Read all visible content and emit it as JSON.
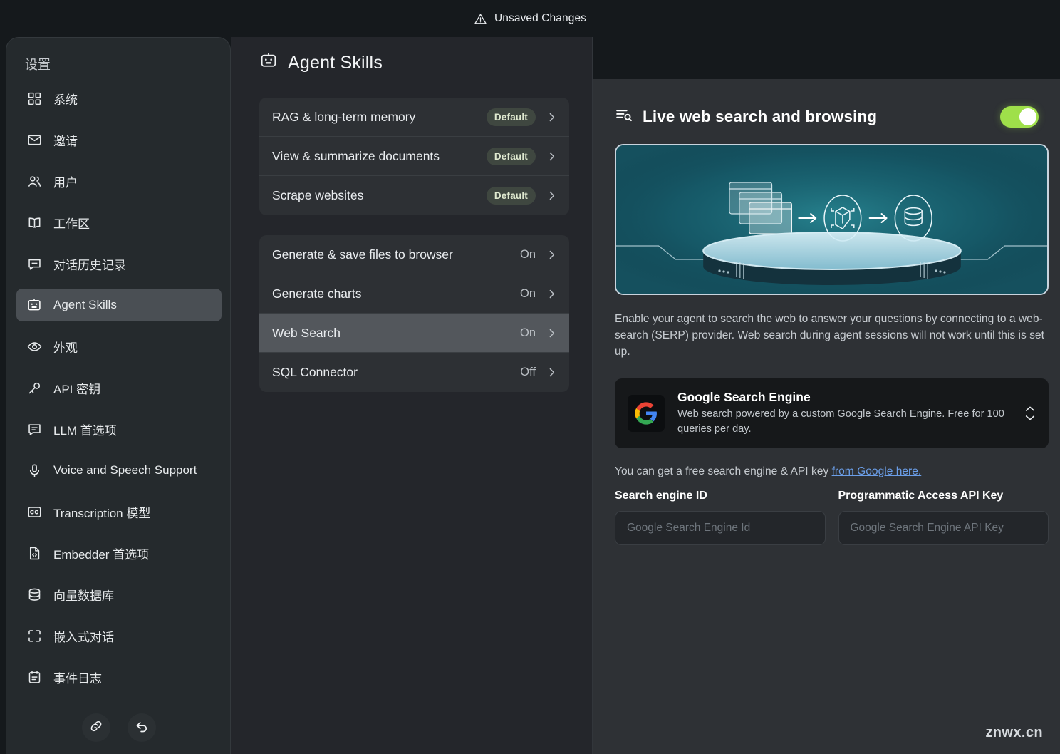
{
  "topbar": {
    "unsaved_label": "Unsaved Changes",
    "warning_icon": "warning-triangle-icon"
  },
  "sidebar": {
    "title": "设置",
    "items": [
      {
        "label": "系统",
        "icon": "grid-icon",
        "active": false
      },
      {
        "label": "邀请",
        "icon": "envelope-icon",
        "active": false
      },
      {
        "label": "用户",
        "icon": "users-icon",
        "active": false
      },
      {
        "label": "工作区",
        "icon": "book-open-icon",
        "active": false
      },
      {
        "label": "对话历史记录",
        "icon": "chat-bubble-icon",
        "active": false
      },
      {
        "label": "Agent Skills",
        "icon": "robot-icon",
        "active": true
      },
      {
        "label": "外观",
        "icon": "eye-icon",
        "active": false
      },
      {
        "label": "API 密钥",
        "icon": "key-icon",
        "active": false
      },
      {
        "label": "LLM 首选项",
        "icon": "chat-lines-icon",
        "active": false
      },
      {
        "label": "Voice and Speech Support",
        "icon": "microphone-icon",
        "active": false
      },
      {
        "label": "Transcription 模型",
        "icon": "closed-caption-icon",
        "active": false
      },
      {
        "label": "Embedder 首选项",
        "icon": "file-code-icon",
        "active": false
      },
      {
        "label": "向量数据库",
        "icon": "database-icon",
        "active": false
      },
      {
        "label": "嵌入式对话",
        "icon": "embed-icon",
        "active": false
      },
      {
        "label": "事件日志",
        "icon": "clipboard-icon",
        "active": false
      }
    ],
    "footer": [
      {
        "name": "link-button",
        "icon": "link-icon"
      },
      {
        "name": "back-button",
        "icon": "undo-arrow-icon"
      }
    ]
  },
  "main": {
    "heading": "Agent Skills",
    "heading_icon": "robot-icon",
    "groups": [
      {
        "rows": [
          {
            "label": "RAG & long-term memory",
            "badge": "Default",
            "state": "",
            "selected": false
          },
          {
            "label": "View & summarize documents",
            "badge": "Default",
            "state": "",
            "selected": false
          },
          {
            "label": "Scrape websites",
            "badge": "Default",
            "state": "",
            "selected": false
          }
        ]
      },
      {
        "rows": [
          {
            "label": "Generate & save files to browser",
            "badge": "",
            "state": "On",
            "selected": false
          },
          {
            "label": "Generate charts",
            "badge": "",
            "state": "On",
            "selected": false
          },
          {
            "label": "Web Search",
            "badge": "",
            "state": "On",
            "selected": true
          },
          {
            "label": "SQL Connector",
            "badge": "",
            "state": "Off",
            "selected": false
          }
        ]
      }
    ]
  },
  "detail": {
    "title": "Live web search and browsing",
    "title_icon": "search-list-icon",
    "toggle_on": true,
    "toggle_color": "#9fe04a",
    "hero_alt": "browser windows to cube to database pipeline illustration",
    "description": "Enable your agent to search the web to answer your questions by connecting to a web-search (SERP) provider. Web search during agent sessions will not work until this is set up.",
    "provider": {
      "name": "Google Search Engine",
      "description": "Web search powered by a custom Google Search Engine. Free for 100 queries per day.",
      "logo_icon": "google-logo-icon",
      "stepper_icon": "chevron-up-down-icon"
    },
    "helper_prefix": "You can get a free search engine & API key ",
    "helper_link": "from Google here.",
    "fields": [
      {
        "label": "Search engine ID",
        "placeholder": "Google Search Engine Id",
        "value": ""
      },
      {
        "label": "Programmatic Access API Key",
        "placeholder": "Google Search Engine API Key",
        "value": ""
      }
    ]
  },
  "watermark": "znwx.cn"
}
